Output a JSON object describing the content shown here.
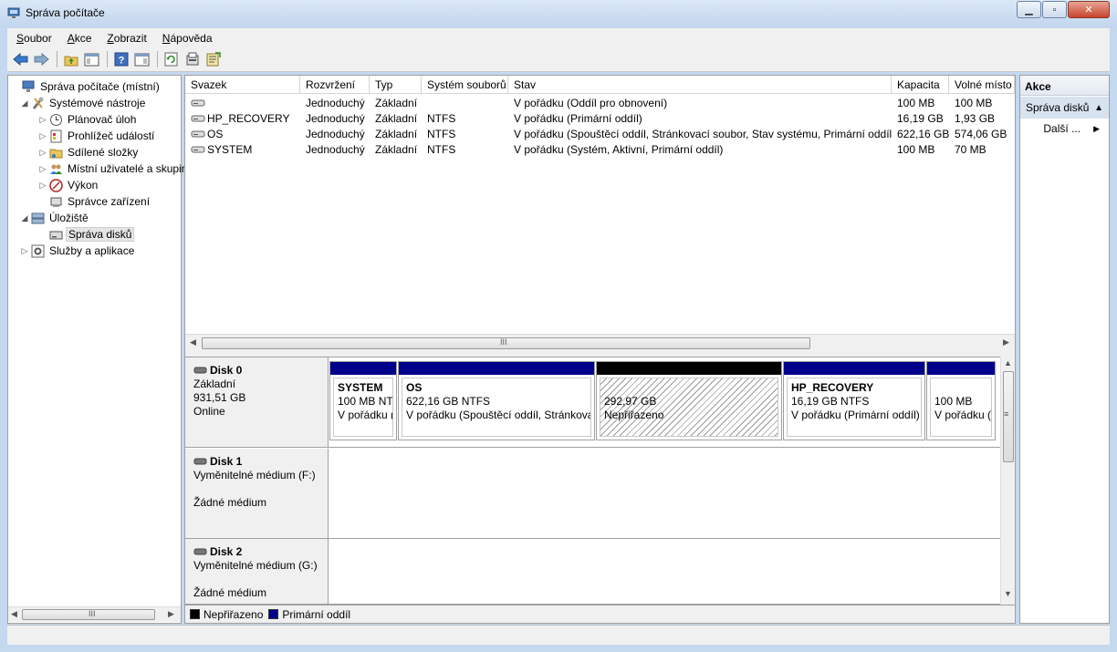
{
  "window": {
    "title": "Správa počítače"
  },
  "menu": [
    {
      "underline": "S",
      "rest": "oubor"
    },
    {
      "underline": "A",
      "rest": "kce"
    },
    {
      "underline": "Z",
      "rest": "obrazit"
    },
    {
      "underline": "N",
      "rest": "ápověda"
    }
  ],
  "toolbar": {
    "icons": [
      "back-arrow-icon",
      "forward-arrow-icon",
      "up-folder-icon",
      "show-hide-tree-icon",
      "help-icon",
      "show-hide-action-pane-icon",
      "refresh-icon",
      "properties-icon",
      "export-list-icon"
    ]
  },
  "tree": {
    "items": [
      {
        "label": "Správa počítače (místní)",
        "arrow": "",
        "icon": "computer-management-icon",
        "level": 0
      },
      {
        "label": "Systémové nástroje",
        "arrow": "◢",
        "icon": "tools-icon",
        "level": 1
      },
      {
        "label": "Plánovač úloh",
        "arrow": "▷",
        "icon": "clock-icon",
        "level": 2
      },
      {
        "label": "Prohlížeč událostí",
        "arrow": "▷",
        "icon": "event-viewer-icon",
        "level": 2
      },
      {
        "label": "Sdílené složky",
        "arrow": "▷",
        "icon": "shared-folder-icon",
        "level": 2
      },
      {
        "label": "Místní uživatelé a skupiny",
        "arrow": "▷",
        "icon": "users-icon",
        "level": 2
      },
      {
        "label": "Výkon",
        "arrow": "▷",
        "icon": "performance-icon",
        "level": 2
      },
      {
        "label": "Správce zařízení",
        "arrow": "",
        "icon": "device-manager-icon",
        "level": 2
      },
      {
        "label": "Úložiště",
        "arrow": "◢",
        "icon": "storage-icon",
        "level": 1
      },
      {
        "label": "Správa disků",
        "arrow": "",
        "icon": "disk-management-icon",
        "level": 2,
        "selected": true
      },
      {
        "label": "Služby a aplikace",
        "arrow": "▷",
        "icon": "services-icon",
        "level": 1
      }
    ]
  },
  "volume_list": {
    "headers": [
      "Svazek",
      "Rozvržení",
      "Typ",
      "Systém souborů",
      "Stav",
      "Kapacita",
      "Volné místo"
    ],
    "rows": [
      {
        "volume": "",
        "layout": "Jednoduchý",
        "type": "Základní",
        "fs": "",
        "status": "V pořádku (Oddíl pro obnovení)",
        "capacity": "100 MB",
        "free": "100 MB"
      },
      {
        "volume": "HP_RECOVERY",
        "layout": "Jednoduchý",
        "type": "Základní",
        "fs": "NTFS",
        "status": "V pořádku (Primární oddíl)",
        "capacity": "16,19 GB",
        "free": "1,93 GB"
      },
      {
        "volume": "OS",
        "layout": "Jednoduchý",
        "type": "Základní",
        "fs": "NTFS",
        "status": "V pořádku (Spouštěcí oddíl, Stránkovací soubor, Stav systému, Primární oddíl)",
        "capacity": "622,16 GB",
        "free": "574,06 GB"
      },
      {
        "volume": "SYSTEM",
        "layout": "Jednoduchý",
        "type": "Základní",
        "fs": "NTFS",
        "status": "V pořádku (Systém, Aktivní, Primární oddíl)",
        "capacity": "100 MB",
        "free": "70 MB"
      }
    ],
    "scroll_grip": "III"
  },
  "disks": [
    {
      "name": "Disk 0",
      "line1": "Základní",
      "line2": "931,51 GB",
      "line3": "Online",
      "partitions": [
        {
          "name": "SYSTEM",
          "size": "100 MB NT",
          "status": "V pořádku (",
          "kind": "primary"
        },
        {
          "name": "OS",
          "size": "622,16 GB NTFS",
          "status": "V pořádku (Spouštěcí oddíl, Stránkova",
          "kind": "primary"
        },
        {
          "name": "",
          "size": "292,97 GB",
          "status": "Nepřiřazeno",
          "kind": "unallocated"
        },
        {
          "name": "HP_RECOVERY",
          "size": "16,19 GB NTFS",
          "status": "V pořádku (Primární oddíl)",
          "kind": "primary"
        },
        {
          "name": "",
          "size": "100 MB",
          "status": "V pořádku (",
          "kind": "primary"
        }
      ]
    },
    {
      "name": "Disk 1",
      "line1": "Vyměnitelné médium (F:)",
      "line2": "",
      "line3": "Žádné médium"
    },
    {
      "name": "Disk 2",
      "line1": "Vyměnitelné médium (G:)",
      "line2": "",
      "line3": "Žádné médium"
    }
  ],
  "legend": [
    {
      "label": "Nepřiřazeno",
      "color": "#000000"
    },
    {
      "label": "Primární oddíl",
      "color": "#00008b"
    }
  ],
  "actions": {
    "header": "Akce",
    "section": "Správa disků",
    "more": "Další ..."
  },
  "colors": {
    "primary_partition": "#00008b",
    "unallocated": "#000000",
    "selection": "#d8e3f0"
  }
}
